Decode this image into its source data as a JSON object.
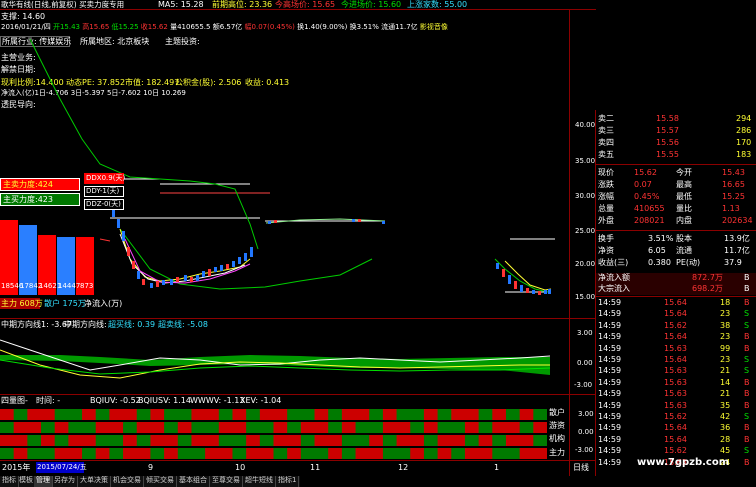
{
  "header": {
    "title": "歌华有线(日线,前复权) 买卖力度专用",
    "ma_label": "MA5: 15.28",
    "prev_high": "前期高位: 23.36",
    "today_buy": "今高场价: 15.65",
    "today_enter": "今进场价: 15.60",
    "up_limit": "上涨家数: 55.00",
    "support": "支撑: 14.60",
    "date_line": {
      "date": "2016/01/21/四",
      "open": "开15.43",
      "high": "高15.65",
      "low": "低15.25",
      "close": "收15.62",
      "volume": "量410655.5",
      "amount": "额6.57亿",
      "change": "幅0.07(0.45%)",
      "turnover": "换1.40(9.00%)",
      "hand": "换3.51%",
      "float": "流通11.7亿",
      "note": "影视音像"
    }
  },
  "info_panel": {
    "industry": "所属行业: 传媒娱乐",
    "region": "所属地区: 北京板块",
    "concept": "主题投资:",
    "main_business": "主营业务:",
    "unlock_date": "解禁日期:",
    "ratio": "现利比例:14.400",
    "pe": "动态PE: 37.852",
    "market_value": "市值: 182.497",
    "fund": "公积金(股): 2.506",
    "income": "收益: 0.413",
    "net_inflow": "净流入(亿)1日-4.706 3日-5.397 5日-7.602 10日 10.269",
    "attitude": "透民导向:"
  },
  "force_panel": {
    "main_sell": "主卖力度:424",
    "main_buy": "主买力度:423",
    "bars": [
      "18546",
      "17842",
      "14621",
      "14447",
      "873"
    ],
    "main_force": "主力 608万",
    "retail": "散户 175万",
    "net_flow": "净流入(万)",
    "ddx": "DDX0.9(天)",
    "ddy": "DDY-1(天)",
    "ddz": "DDZ-0(天)"
  },
  "price_axis": [
    "40.00",
    "35.00",
    "30.00",
    "25.00",
    "20.00",
    "15.00"
  ],
  "mid_indicator": {
    "label1": "中期方向线1: -3.67",
    "label2": "中期方向线:",
    "label3": "超买线: 0.39",
    "label4": "超卖线: -5.08",
    "axis": [
      "3.00",
      "0.00",
      "-3.00"
    ]
  },
  "bottom_indicator": {
    "label_main": "四量图-",
    "label_time": "时间: -",
    "bqiuv": "BQIUV: -0.52",
    "bqiusv": "BQIUSV: 1.14",
    "wwwv": "WWWV: -1.13",
    "xev": "XEV: -1.04",
    "rows": [
      "散户",
      "游资",
      "机构",
      "主力"
    ],
    "axis": [
      "3.00",
      "0.00",
      "-3.00"
    ]
  },
  "date_axis": {
    "year": "2015年",
    "selected": "2015/07/24/五",
    "ticks": [
      "9",
      "10",
      "11",
      "12",
      "1"
    ],
    "period": "日线"
  },
  "tabs": [
    "指标",
    "模板",
    "管理",
    "另存为",
    "大单决策",
    "机会交易",
    "倾买交易",
    "基本组合",
    "至尊交易",
    "超牛短线",
    "指标1"
  ],
  "quote": {
    "sells": [
      {
        "label": "卖二",
        "price": "15.58",
        "vol": "294"
      },
      {
        "label": "卖三",
        "price": "15.57",
        "vol": "286"
      },
      {
        "label": "卖四",
        "price": "15.56",
        "vol": "170"
      },
      {
        "label": "卖五",
        "price": "15.55",
        "vol": "183"
      }
    ],
    "stats": [
      {
        "l1": "现价",
        "v1": "15.62",
        "l2": "今开",
        "v2": "15.43"
      },
      {
        "l1": "涨跌",
        "v1": "0.07",
        "l2": "最高",
        "v2": "16.65"
      },
      {
        "l1": "涨幅",
        "v1": "0.45%",
        "l2": "最低",
        "v2": "15.25"
      },
      {
        "l1": "总量",
        "v1": "410655",
        "l2": "量比",
        "v2": "1.13"
      },
      {
        "l1": "外盘",
        "v1": "208021",
        "l2": "内盘",
        "v2": "202634"
      }
    ],
    "stats2": [
      {
        "l1": "换手",
        "v1": "3.51%",
        "l2": "股本",
        "v2": "13.9亿"
      },
      {
        "l1": "净资",
        "v1": "6.05",
        "l2": "流通",
        "v2": "11.7亿"
      },
      {
        "l1": "收益(三)",
        "v1": "0.380",
        "l2": "PE(动)",
        "v2": "37.9"
      }
    ],
    "flows": [
      {
        "label": "净流入额",
        "value": "872.7万",
        "unit": "B"
      },
      {
        "label": "大宗流入",
        "value": "698.2万",
        "unit": "B"
      }
    ],
    "ticks": [
      {
        "time": "14:59",
        "price": "15.64",
        "vol": "18",
        "bs": "B"
      },
      {
        "time": "14:59",
        "price": "15.64",
        "vol": "23",
        "bs": "S"
      },
      {
        "time": "14:59",
        "price": "15.62",
        "vol": "38",
        "bs": "S"
      },
      {
        "time": "14:59",
        "price": "15.64",
        "vol": "23",
        "bs": "B"
      },
      {
        "time": "14:59",
        "price": "15.63",
        "vol": "99",
        "bs": "B"
      },
      {
        "time": "14:59",
        "price": "15.64",
        "vol": "23",
        "bs": "S"
      },
      {
        "time": "14:59",
        "price": "15.63",
        "vol": "21",
        "bs": "S"
      },
      {
        "time": "14:59",
        "price": "15.63",
        "vol": "14",
        "bs": "B"
      },
      {
        "time": "14:59",
        "price": "15.63",
        "vol": "21",
        "bs": "B"
      },
      {
        "time": "14:59",
        "price": "15.63",
        "vol": "35",
        "bs": "B"
      },
      {
        "time": "14:59",
        "price": "15.62",
        "vol": "42",
        "bs": "S"
      },
      {
        "time": "14:59",
        "price": "15.64",
        "vol": "36",
        "bs": "B"
      },
      {
        "time": "14:59",
        "price": "15.64",
        "vol": "28",
        "bs": "B"
      },
      {
        "time": "14:59",
        "price": "15.62",
        "vol": "45",
        "bs": "S"
      },
      {
        "time": "14:59",
        "price": "15.63",
        "vol": "24",
        "bs": "B"
      }
    ]
  },
  "watermark": "www.7gpzb.com",
  "colors": {
    "up": "#ff3333",
    "down": "#00e000",
    "grid": "#8b0000",
    "accent": "#ffff33"
  }
}
